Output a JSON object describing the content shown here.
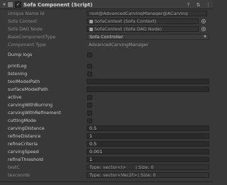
{
  "component": {
    "title": "Sofa Component (Script)",
    "enabled_checkmark": "✓",
    "fold_glyph": "▼",
    "help_glyph": "?",
    "preset_glyph": "⇅",
    "menu_glyph": "⋮"
  },
  "fields": {
    "unique_name_id": {
      "label": "Unique Name Id",
      "value": "root@AdvancedCarvingManager@ACarving"
    },
    "sofa_context": {
      "label": "Sofa Context",
      "value": "SofaContext (Sofa Context)"
    },
    "sofa_dag_node": {
      "label": "Sofa DAG Node",
      "value": "SofaContext (Sofa DAG Node)"
    },
    "base_component_type": {
      "label": "BaseComponentType",
      "value": "Sofa Controller"
    },
    "component_type": {
      "label": "Component Type",
      "value": "AdvancedCarvingManager"
    },
    "dump_logs": {
      "label": "Dump logs"
    },
    "print_log": {
      "label": "printLog"
    },
    "listening": {
      "label": "listening"
    },
    "tool_model_path": {
      "label": "toolModelPath",
      "value": ""
    },
    "surface_model_path": {
      "label": "surfaceModelPath",
      "value": ""
    },
    "active": {
      "label": "active"
    },
    "carving_with_burning": {
      "label": "carvingWithBurning"
    },
    "carving_with_refinement": {
      "label": "carvingWithRefinement"
    },
    "cutting_mode": {
      "label": "cuttingMode"
    },
    "carving_distance": {
      "label": "carvingDistance",
      "value": "0.5"
    },
    "refine_distance": {
      "label": "refineDistance",
      "value": "1"
    },
    "refine_criteria": {
      "label": "refineCriteria",
      "value": "0.5"
    },
    "carving_speed": {
      "label": "carvingSpeed",
      "value": "0.001"
    },
    "refine_threshold": {
      "label": "refineThreshold",
      "value": "1"
    },
    "test_c": {
      "label": "testC",
      "type_text": "Type: vector<I>",
      "size_text": "| Size: 0"
    },
    "texcoords": {
      "label": "texcoords",
      "type_text": "Type: vector<Vec2f>",
      "size_text": "| Size: 0"
    }
  },
  "icons": {
    "component_icon": "script-icon",
    "object_icon": "sofa-object-icon",
    "target_icon": "object-picker-icon"
  },
  "colors": {
    "background": "#383838",
    "header": "#3e3e3e",
    "field": "#2a2a2a",
    "text": "#c8c8c8",
    "dim_text": "#8a8a8a"
  }
}
